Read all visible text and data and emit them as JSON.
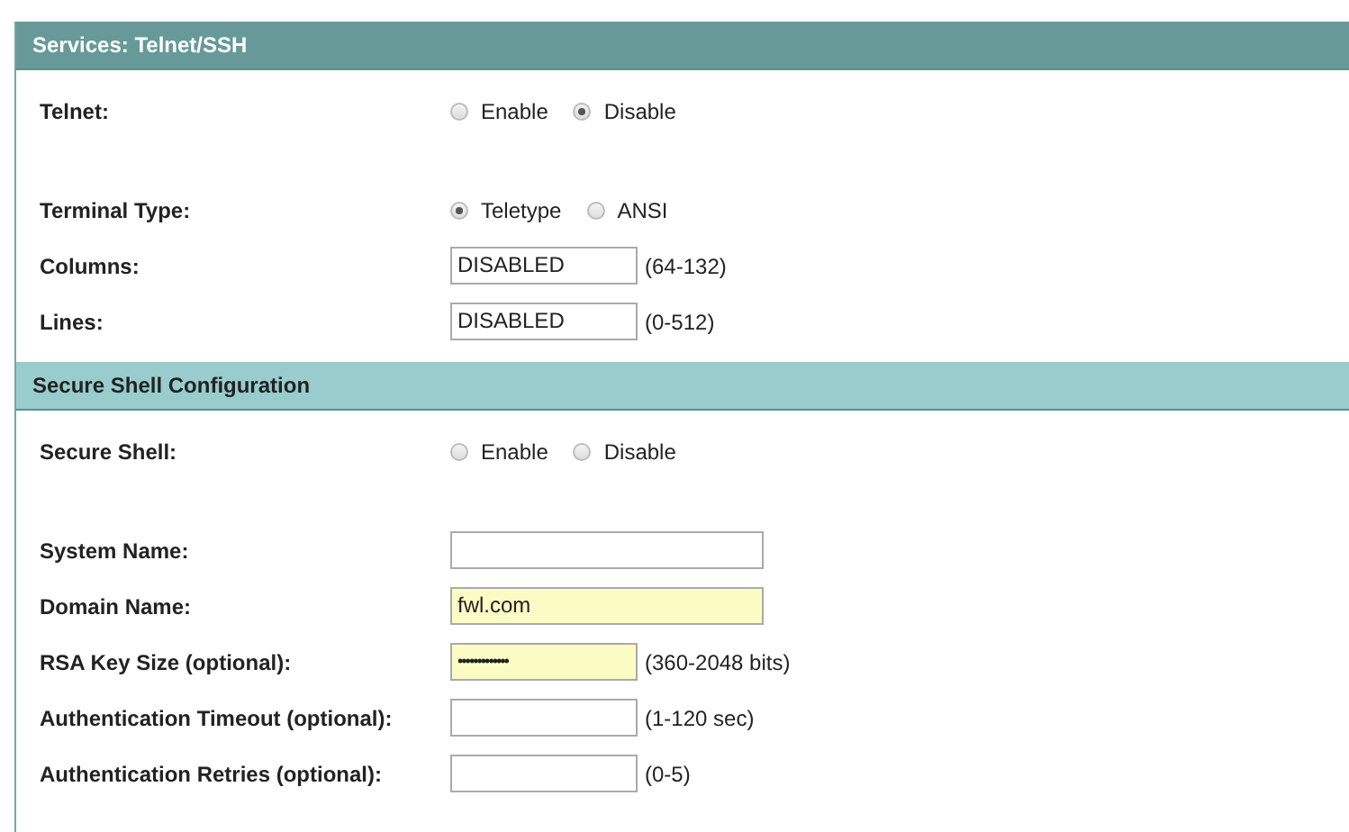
{
  "sections": [
    {
      "title": "Services: Telnet/SSH",
      "kind": "main",
      "groups": [
        [
          {
            "label": "Telnet:",
            "kind": "radio",
            "options": [
              {
                "label": "Enable",
                "selected": false
              },
              {
                "label": "Disable",
                "selected": true
              }
            ]
          }
        ],
        [
          {
            "label": "Terminal Type:",
            "kind": "radio",
            "options": [
              {
                "label": "Teletype",
                "selected": true
              },
              {
                "label": "ANSI",
                "selected": false
              }
            ]
          },
          {
            "label": "Columns:",
            "kind": "field",
            "value": "DISABLED",
            "hint": "(64-132)",
            "autofilled": false
          },
          {
            "label": "Lines:",
            "kind": "field",
            "value": "DISABLED",
            "hint": "(0-512)",
            "autofilled": false
          }
        ]
      ]
    },
    {
      "title": "Secure Shell Configuration",
      "kind": "sub",
      "groups": [
        [
          {
            "label": "Secure Shell:",
            "kind": "radio",
            "options": [
              {
                "label": "Enable",
                "selected": false
              },
              {
                "label": "Disable",
                "selected": false
              }
            ]
          }
        ],
        [
          {
            "label": "System Name:",
            "kind": "wide-field",
            "autofilled": false
          },
          {
            "label": "Domain Name:",
            "kind": "wide-field",
            "value": "fwl.com",
            "autofilled": true
          },
          {
            "label": "RSA Key Size (optional):",
            "kind": "password-field",
            "value": "•••••••••••••",
            "hint": "(360-2048 bits)",
            "autofilled": true
          },
          {
            "label": "Authentication Timeout (optional):",
            "kind": "field",
            "hint": "(1-120 sec)",
            "autofilled": false
          },
          {
            "label": "Authentication Retries (optional):",
            "kind": "field",
            "hint": "(0-5)",
            "autofilled": false
          }
        ]
      ]
    }
  ]
}
